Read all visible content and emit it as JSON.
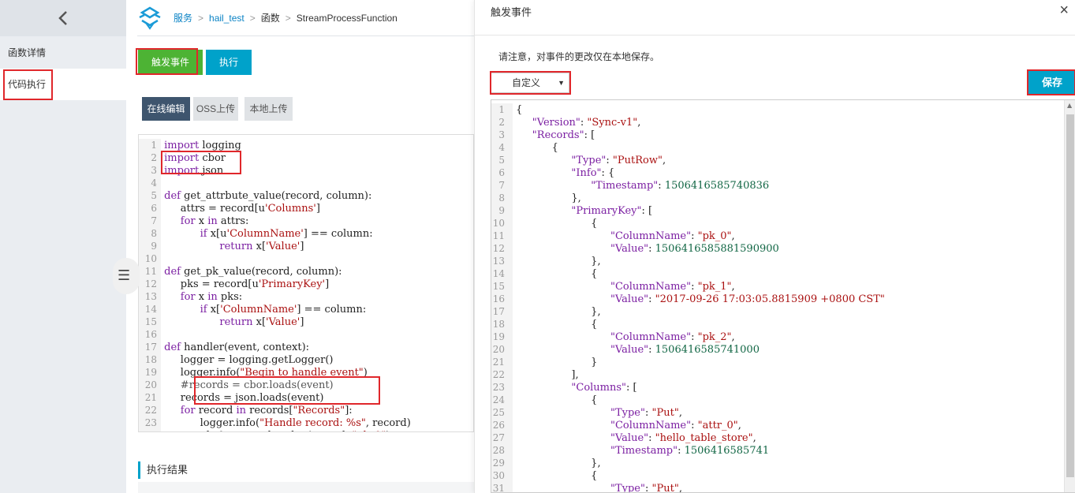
{
  "sidebar": {
    "items": [
      {
        "label": "函数详情"
      },
      {
        "label": "代码执行"
      }
    ]
  },
  "breadcrumb": [
    {
      "label": "服务"
    },
    {
      "label": "hail_test"
    },
    {
      "label": "函数"
    },
    {
      "label": "StreamProcessFunction"
    }
  ],
  "toolbar": {
    "trigger_label": "触发事件",
    "run_label": "执行"
  },
  "tabs": [
    {
      "label": "在线编辑"
    },
    {
      "label": "OSS上传"
    },
    {
      "label": "本地上传"
    }
  ],
  "result": {
    "title": "执行结果"
  },
  "panel": {
    "title": "触发事件",
    "close": "×",
    "notice": "请注意，对事件的更改仅在本地保存。",
    "select_value": "自定义",
    "save_label": "保存"
  },
  "colors": {
    "accent": "#00a2ca",
    "trigger": "#4db334",
    "highlight": "#e0272b"
  },
  "icons": {
    "collapse": "chevron-left-icon",
    "close": "close-icon",
    "handle": "menu-icon"
  }
}
